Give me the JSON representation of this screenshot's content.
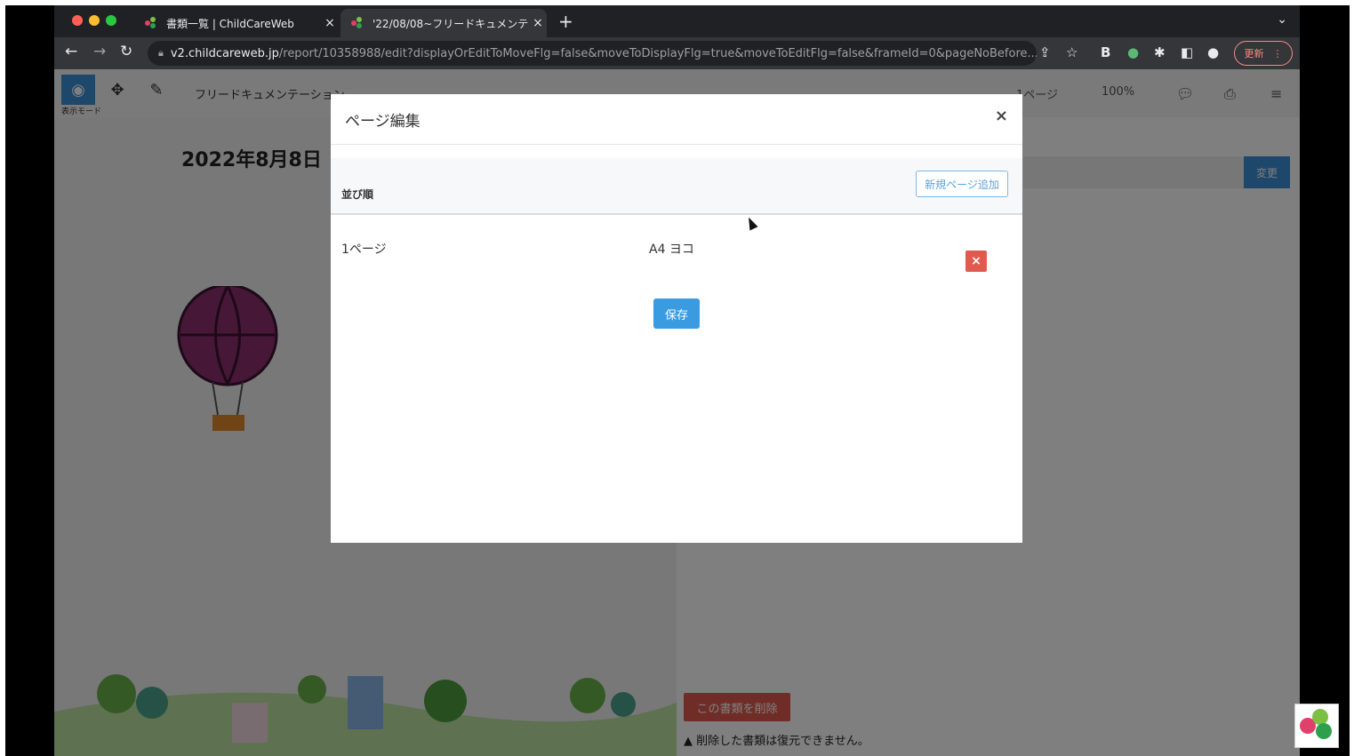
{
  "browser": {
    "tabs": [
      {
        "title": "書類一覧 | ChildCareWeb",
        "close": "×"
      },
      {
        "title": "'22/08/08~フリードキュメンテ",
        "close": "×"
      }
    ],
    "new_tab": "+",
    "tab_menu": "⌄",
    "url_host": "v2.childcareweb.jp",
    "url_path": "/report/10358988/edit?displayOrEditToMoveFlg=false&moveToDisplayFlg=true&moveToEditFlg=false&frameId=0&pageNoBefore...",
    "update_label": "更新"
  },
  "app": {
    "mode_label": "表示モード",
    "doc_title": "フリードキュメンテーション",
    "page_select": "1ページ",
    "zoom": "100%",
    "date_heading": "2022年8月8日",
    "change_label": "変更",
    "delete_doc_label": "この書類を削除",
    "delete_note": "削除した書類は復元できません。"
  },
  "modal": {
    "title": "ページ編集",
    "close": "×",
    "sort_header": "並び順",
    "add_page_label": "新規ページ追加",
    "rows": [
      {
        "name": "1ページ",
        "size": "A4 ヨコ",
        "delete": "×"
      }
    ],
    "save_label": "保存"
  },
  "colors": {
    "primary": "#3b9be0",
    "danger": "#e05a4e",
    "chrome_dark": "#202124"
  }
}
